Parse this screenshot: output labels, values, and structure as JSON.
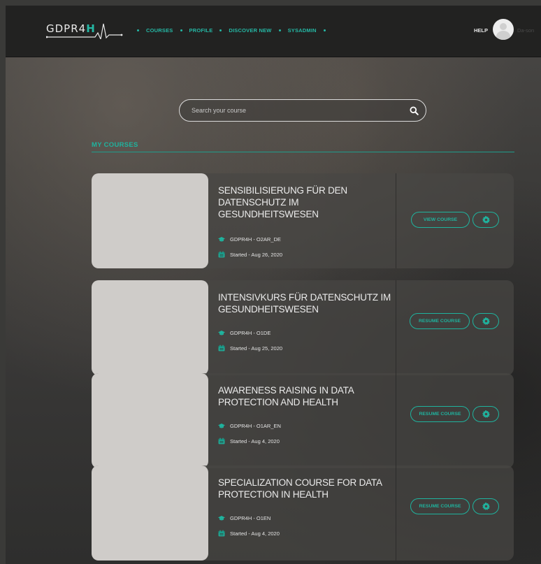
{
  "header": {
    "logo_text_main": "GDPR4",
    "logo_text_accent": "H",
    "nav": [
      {
        "label": "COURSES"
      },
      {
        "label": "PROFILE"
      },
      {
        "label": "DISCOVER NEW"
      },
      {
        "label": "SYSADMIN"
      }
    ],
    "help_label": "HELP",
    "username": "Da-son"
  },
  "search": {
    "placeholder": "Search your course"
  },
  "section": {
    "title": "MY COURSES"
  },
  "courses": [
    {
      "title": "SENSIBILISIERUNG FÜR DEN DATENSCHUTZ IM GESUNDHEITSWESEN",
      "code": "GDPR4H - O2AR_DE",
      "started": "Started - Aug 26, 2020",
      "action": "VIEW COURSE"
    },
    {
      "title": "INTENSIVKURS FÜR DATENSCHUTZ IM GESUNDHEITSWESEN",
      "code": "GDPR4H - O1DE",
      "started": "Started - Aug 25, 2020",
      "action": "RESUME COURSE"
    },
    {
      "title": "AWARENESS RAISING IN DATA PROTECTION AND HEALTH",
      "code": "GDPR4H - O1AR_EN",
      "started": "Started - Aug 4, 2020",
      "action": "RESUME COURSE"
    },
    {
      "title": "SPECIALIZATION COURSE FOR DATA PROTECTION IN HEALTH",
      "code": "GDPR4H - O1EN",
      "started": "Started - Aug 4, 2020",
      "action": "RESUME COURSE"
    }
  ],
  "colors": {
    "accent": "#1fb39e",
    "topbar": "#222221",
    "card_bg": "#484644",
    "thumb": "#cfccc9"
  },
  "icons": {
    "search": "search-icon",
    "course": "graduation-cap-icon",
    "calendar": "calendar-icon",
    "settings": "gear-icon"
  }
}
